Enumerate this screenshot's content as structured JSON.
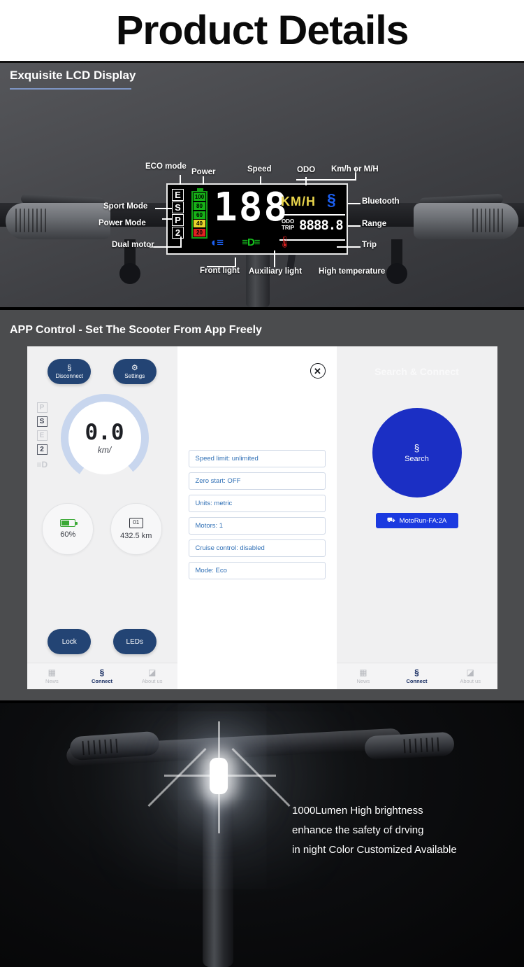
{
  "page_title": "Product Details",
  "section_lcd": {
    "heading": "Exquisite LCD Display",
    "callouts": {
      "eco_mode": "ECO mode",
      "power": "Power",
      "speed": "Speed",
      "odo": "ODO",
      "unit": "Km/h or M/H",
      "sport_mode": "Sport Mode",
      "power_mode": "Power Mode",
      "dual_motor": "Dual motor",
      "bluetooth": "Bluetooth",
      "range": "Range",
      "trip": "Trip",
      "front_light": "Front light",
      "auxiliary_light": "Auxiliary light",
      "high_temperature": "High temperature"
    },
    "screen": {
      "modes": [
        "E",
        "S",
        "P",
        "2"
      ],
      "battery_levels": [
        "100",
        "80",
        "60",
        "40",
        "20"
      ],
      "speed_value": "188",
      "unit_label": "KM/H",
      "odo_label": "ODO",
      "trip_label": "TRIP",
      "range_value": "8888.8",
      "bluetooth_icon": "bluetooth-icon",
      "headlight_icon": "headlight-icon",
      "aux_light_icon": "aux-light-icon",
      "temperature_icon": "thermometer-icon"
    }
  },
  "section_app": {
    "heading": "APP Control - Set The Scooter From App Freely",
    "phone_left": {
      "disconnect_label": "Disconnect",
      "settings_label": "Settings",
      "modes": [
        "P",
        "S",
        "E",
        "2"
      ],
      "active_modes": [
        "S",
        "2"
      ],
      "speed_value": "0.0",
      "speed_unit": "km/",
      "battery_percent": "60%",
      "distance": "432.5 km",
      "lock_label": "Lock",
      "leds_label": "LEDs",
      "nav": [
        {
          "label": "News",
          "icon": "news-icon"
        },
        {
          "label": "Connect",
          "icon": "bluetooth-icon"
        },
        {
          "label": "About us",
          "icon": "about-icon"
        }
      ]
    },
    "phone_middle": {
      "close_label": "✕",
      "settings": [
        "Speed limit: unlimited",
        "Zero start: OFF",
        "Units: metric",
        "Motors: 1",
        "Cruise control: disabled",
        "Mode: Eco"
      ]
    },
    "phone_right": {
      "title": "Search & Connect",
      "search_label": "Search",
      "device_name": "MotoRun-FA:2A",
      "nav": [
        {
          "label": "News",
          "icon": "news-icon"
        },
        {
          "label": "Connect",
          "icon": "bluetooth-icon"
        },
        {
          "label": "About us",
          "icon": "about-icon"
        }
      ]
    }
  },
  "section_light": {
    "lines": [
      "1000Lumen High brightness",
      "enhance the safety of drving",
      "in night Color Customized Available"
    ]
  },
  "colors": {
    "accent_blue": "#234474",
    "bright_blue": "#1b2fc4",
    "link_blue": "#2f6fb5",
    "dark_bg": "#4b4c4e",
    "battery_green": "#3ba935"
  }
}
